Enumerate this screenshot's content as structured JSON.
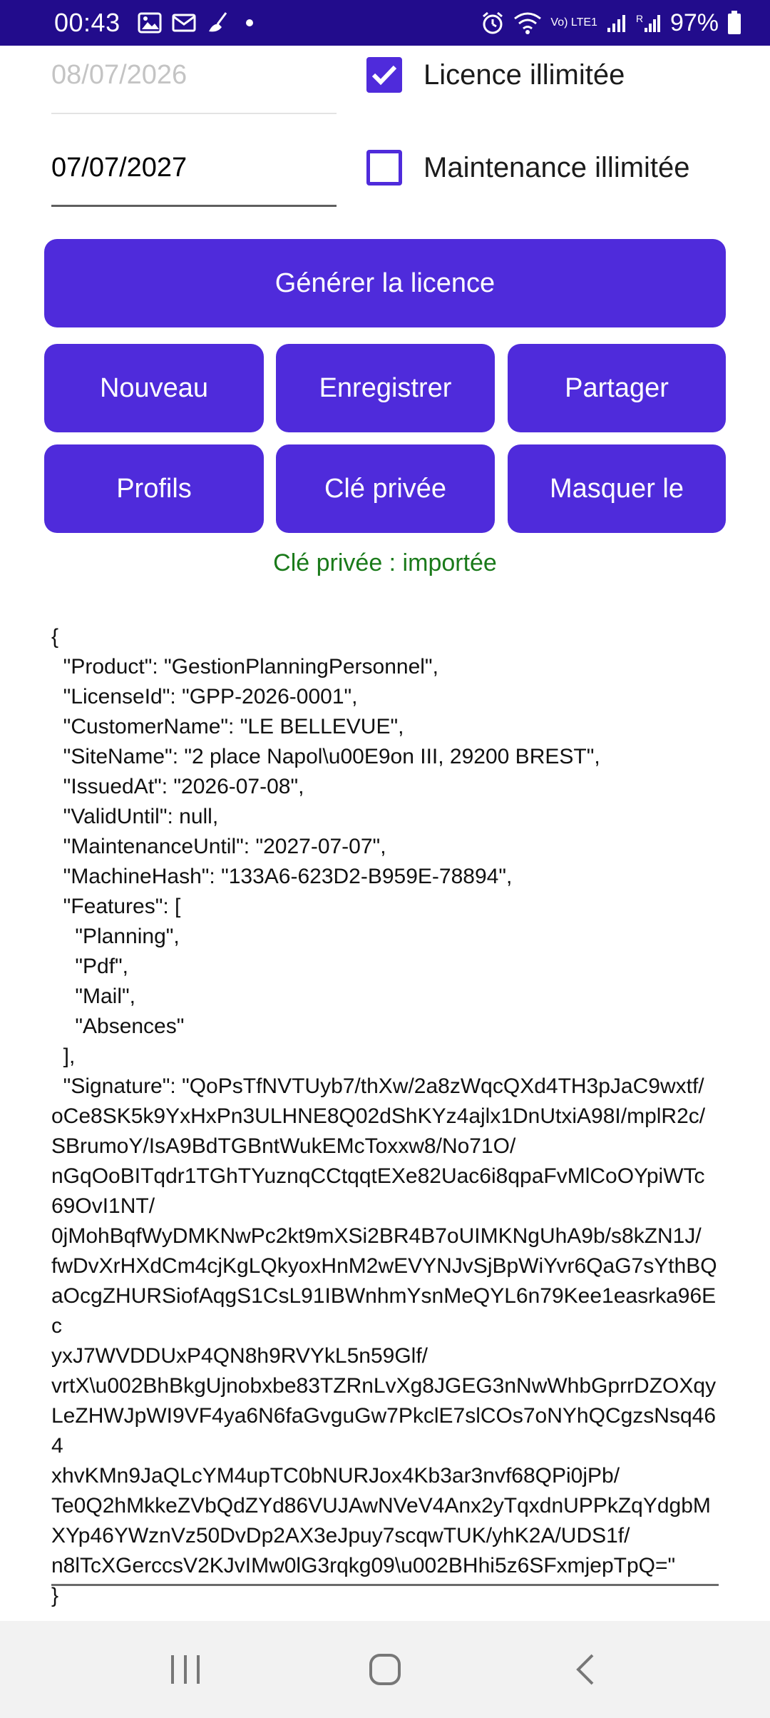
{
  "status_bar": {
    "time": "00:43",
    "battery": "97%",
    "network_label": "Vo) LTE1"
  },
  "form": {
    "issue_date": "08/07/2026",
    "unlimited_license_label": "Licence illimitée",
    "unlimited_license_checked": true,
    "maintenance_date": "07/07/2027",
    "unlimited_maintenance_label": "Maintenance illimitée",
    "unlimited_maintenance_checked": false
  },
  "buttons": {
    "generate": "Générer la licence",
    "new": "Nouveau",
    "save": "Enregistrer",
    "share": "Partager",
    "profiles": "Profils",
    "private_key": "Clé privée",
    "hide": "Masquer le"
  },
  "status_message": "Clé privée : importée",
  "license_json": "{\n  \"Product\": \"GestionPlanningPersonnel\",\n  \"LicenseId\": \"GPP-2026-0001\",\n  \"CustomerName\": \"LE BELLEVUE\",\n  \"SiteName\": \"2 place Napol\\u00E9on III, 29200 BREST\",\n  \"IssuedAt\": \"2026-07-08\",\n  \"ValidUntil\": null,\n  \"MaintenanceUntil\": \"2027-07-07\",\n  \"MachineHash\": \"133A6-623D2-B959E-78894\",\n  \"Features\": [\n    \"Planning\",\n    \"Pdf\",\n    \"Mail\",\n    \"Absences\"\n  ],\n  \"Signature\": \"QoPsTfNVTUyb7/thXw/2a8zWqcQXd4TH3pJaC9wxtf/\noCe8SK5k9YxHxPn3ULHNE8Q02dShKYz4ajlx1DnUtxiA98I/mplR2c/\nSBrumoY/IsA9BdTGBntWukEMcToxxw8/No71O/\nnGqOoBITqdr1TGhTYuznqCCtqqtEXe82Uac6i8qpaFvMlCoOYpiWTc\n69OvI1NT/\n0jMohBqfWyDMKNwPc2kt9mXSi2BR4B7oUIMKNgUhA9b/s8kZN1J/\nfwDvXrHXdCm4cjKgLQkyoxHnM2wEVYNJvSjBpWiYvr6QaG7sYthBQ\naOcgZHURSiofAqgS1CsL91IBWnhmYsnMeQYL6n79Kee1easrka96Ec\nyxJ7WVDDUxP4QN8h9RVYkL5n59Glf/\nvrtX\\u002BhBkgUjnobxbe83TZRnLvXg8JGEG3nNwWhbGprrDZOXqy\nLeZHWJpWI9VF4ya6N6faGvguGw7PkclE7slCOs7oNYhQCgzsNsq464\nxhvKMn9JaQLcYM4upTC0bNURJox4Kb3ar3nvf68QPi0jPb/\nTe0Q2hMkkeZVbQdZYd86VUJAwNVeV4Anx2yTqxdnUPPkZqYdgbM\nXYp46YWznVz50DvDp2AX3eJpuy7scqwTUK/yhK2A/UDS1f/\nn8lTcXGerccsV2KJvIMw0lG3rqkg09\\u002BHhi5z6SFxmjepTpQ=\"\n}"
}
